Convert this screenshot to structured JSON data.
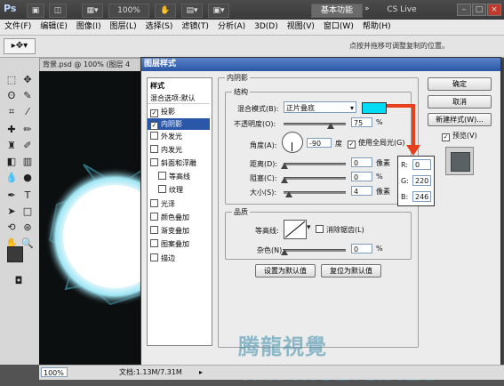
{
  "app": {
    "logo": "Ps",
    "zoom": "100%",
    "workspace": "基本功能",
    "cslive": "CS Live"
  },
  "menu": [
    "文件(F)",
    "编辑(E)",
    "图像(I)",
    "图层(L)",
    "选择(S)",
    "滤镜(T)",
    "分析(A)",
    "3D(D)",
    "视图(V)",
    "窗口(W)",
    "帮助(H)"
  ],
  "options": {
    "hint": "点按并拖移可调整复制的位置。"
  },
  "document": {
    "tab": "背景.psd @ 100% (图层 4",
    "zoom": "100%",
    "doc_size": "文档:1.13M/7.31M"
  },
  "dialog": {
    "title": "图层样式",
    "styles": [
      {
        "label": "样式",
        "checkbox": false,
        "checked": false,
        "selected": false
      },
      {
        "label": "混合选项:默认",
        "checkbox": false,
        "checked": false,
        "selected": false
      },
      {
        "label": "投影",
        "checkbox": true,
        "checked": true,
        "selected": false
      },
      {
        "label": "内阴影",
        "checkbox": true,
        "checked": true,
        "selected": true
      },
      {
        "label": "外发光",
        "checkbox": true,
        "checked": false,
        "selected": false
      },
      {
        "label": "内发光",
        "checkbox": true,
        "checked": false,
        "selected": false
      },
      {
        "label": "斜面和浮雕",
        "checkbox": true,
        "checked": false,
        "selected": false
      },
      {
        "label": "等高线",
        "checkbox": true,
        "checked": false,
        "selected": false,
        "indent": true
      },
      {
        "label": "纹理",
        "checkbox": true,
        "checked": false,
        "selected": false,
        "indent": true
      },
      {
        "label": "光泽",
        "checkbox": true,
        "checked": false,
        "selected": false
      },
      {
        "label": "颜色叠加",
        "checkbox": true,
        "checked": false,
        "selected": false
      },
      {
        "label": "渐变叠加",
        "checkbox": true,
        "checked": false,
        "selected": false
      },
      {
        "label": "图案叠加",
        "checkbox": true,
        "checked": false,
        "selected": false
      },
      {
        "label": "描边",
        "checkbox": true,
        "checked": false,
        "selected": false
      }
    ],
    "section_title": "内阴影",
    "structure": {
      "title": "结构",
      "blend_mode_label": "混合模式(B):",
      "blend_mode_value": "正片叠底",
      "shadow_color": "#00dcf6",
      "opacity_label": "不透明度(O):",
      "opacity_value": "75",
      "opacity_fraction": 0.75,
      "percent": "%",
      "angle_label": "角度(A):",
      "angle_value": "-90",
      "angle_unit": "度",
      "global_light_label": "使用全局光(G)",
      "distance_label": "距离(D):",
      "distance_value": "0",
      "choke_label": "阻塞(C):",
      "choke_value": "0",
      "size_label": "大小(S):",
      "size_value": "4",
      "pixel_unit": "像素"
    },
    "quality": {
      "title": "品质",
      "contour_label": "等高线:",
      "anti_alias_label": "消除锯齿(L)",
      "noise_label": "杂色(N):",
      "noise_value": "0",
      "percent": "%"
    },
    "buttons": {
      "make_default": "设置为默认值",
      "reset_default": "复位为默认值",
      "ok": "确定",
      "cancel": "取消",
      "new_style": "新建样式(W)...",
      "preview": "预览(V)"
    },
    "rgb": {
      "r_label": "R:",
      "r": "0",
      "g_label": "G:",
      "g": "220",
      "b_label": "B:",
      "b": "246"
    }
  },
  "watermark": "腾龍視覺WWW.TLVI.NET",
  "colors": {
    "accent": "#2b57a8",
    "arrow": "#e8401c",
    "cyan": "#00dcf6"
  }
}
